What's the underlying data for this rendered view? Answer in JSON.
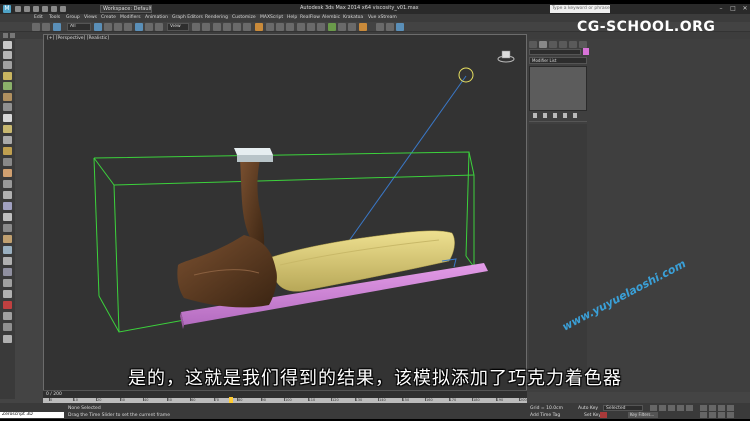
{
  "titlebar": {
    "workspace": "Workspace: Default",
    "title": "Autodesk 3ds Max 2014 x64    viscosity_v01.max",
    "search_placeholder": "Type a keyword or phrase"
  },
  "menu": [
    "Edit",
    "Tools",
    "Group",
    "Views",
    "Create",
    "Modifiers",
    "Animation",
    "Graph Editors",
    "Rendering",
    "Customize",
    "MAXScript",
    "Help",
    "RealFlow",
    "Alembic",
    "Krakatoa",
    "Vue xStream"
  ],
  "toolbar": {
    "filter_value": "All",
    "view_value": "View"
  },
  "viewport": {
    "label": "[+] [Perspective] [Realistic]"
  },
  "subtitle": "是的，这就是我们得到的结果，该模拟添加了巧克力着色器",
  "watermark": "www.yuyuelaoshi.com",
  "brand": "CG-SCHOOL.ORG",
  "command_panel": {
    "modifier_list": "Modifier List"
  },
  "timeline": {
    "frame_counter": "0 / 200",
    "ticks": [
      "0",
      "10",
      "20",
      "30",
      "40",
      "50",
      "60",
      "70",
      "80",
      "90",
      "100",
      "110",
      "120",
      "130",
      "140",
      "150",
      "160",
      "170",
      "180",
      "190",
      "200"
    ]
  },
  "statusbar": {
    "script_text": "Zeroscript 3D",
    "selection_status": "None Selected",
    "prompt": "Drag the Time Slider to set the current frame",
    "grid": "Grid = 10.0cm",
    "add_time_tag": "Add Time Tag",
    "auto_key": "Auto Key",
    "set_key": "Set Key",
    "selected_value": "Selected",
    "key_filters": "Key Filters..."
  },
  "colors": {
    "floor": "#d98ce0",
    "chocolate": "#5a3820",
    "foam": "#d8c879",
    "bounding_box": "#3cd23c"
  }
}
